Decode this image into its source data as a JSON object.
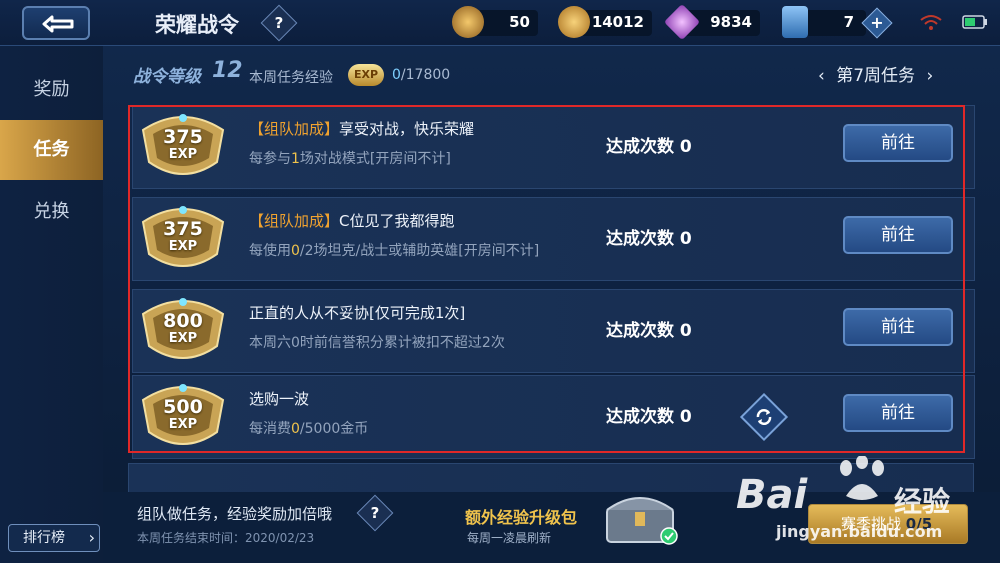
{
  "header": {
    "title": "荣耀战令",
    "help_label": "?",
    "resources": [
      {
        "icon": "ticket-icon",
        "value": "50",
        "color": "#d89a3a"
      },
      {
        "icon": "gold-coin-icon",
        "value": "14012",
        "color": "#e0a63a"
      },
      {
        "icon": "diamond-icon",
        "value": "9834",
        "color": "#c97de0"
      },
      {
        "icon": "coupon-card-icon",
        "value": "7",
        "color": "#5aa0e0"
      }
    ],
    "plus_label": "+"
  },
  "sidebar": {
    "items": [
      {
        "label": "奖励",
        "active": false
      },
      {
        "label": "任务",
        "active": true
      },
      {
        "label": "兑换",
        "active": false
      }
    ],
    "rank_button": "排行榜"
  },
  "level_bar": {
    "label": "战令等级",
    "level": "12",
    "week_exp_label": "本周任务经验",
    "exp_icon": "EXP",
    "progress_current": "0",
    "progress_total": "/17800",
    "week_label": "第7周任务"
  },
  "tasks": [
    {
      "exp": "375",
      "exp_unit": "EXP",
      "tag": "【组队加成】",
      "name": "享受对战，快乐荣耀",
      "desc_pre": "每参与",
      "desc_hl": "1",
      "desc_post": "场对战模式[开房间不计]",
      "count_label": "达成次数 0",
      "button": "前往",
      "refresh": false
    },
    {
      "exp": "375",
      "exp_unit": "EXP",
      "tag": "【组队加成】",
      "name": "C位见了我都得跑",
      "desc_pre": "每使用",
      "desc_hl": "0",
      "desc_post": "/2场坦克/战士或辅助英雄[开房间不计]",
      "count_label": "达成次数 0",
      "button": "前往",
      "refresh": false
    },
    {
      "exp": "800",
      "exp_unit": "EXP",
      "tag": "",
      "name": "正直的人从不妥协[仅可完成1次]",
      "desc_pre": "本周六0时前信誉积分累计被扣不超过2次",
      "desc_hl": "",
      "desc_post": "",
      "count_label": "达成次数 0",
      "button": "前往",
      "refresh": false
    },
    {
      "exp": "500",
      "exp_unit": "EXP",
      "tag": "",
      "name": "选购一波",
      "desc_pre": "每消费",
      "desc_hl": "0",
      "desc_post": "/5000金币",
      "count_label": "达成次数 0",
      "button": "前往",
      "refresh": true
    }
  ],
  "footer": {
    "team_tip": "组队做任务，经验奖励加倍哦",
    "help_label": "?",
    "end_time": "本周任务结束时间：2020/02/23",
    "extra_title": "额外经验升级包",
    "extra_sub": "每周一凌晨刷新",
    "season_label": "赛季挑战",
    "season_progress": "0/5"
  },
  "watermark": {
    "brand": "Bai",
    "brand_cn": "经验",
    "url": "jingyan.baidu.com"
  }
}
